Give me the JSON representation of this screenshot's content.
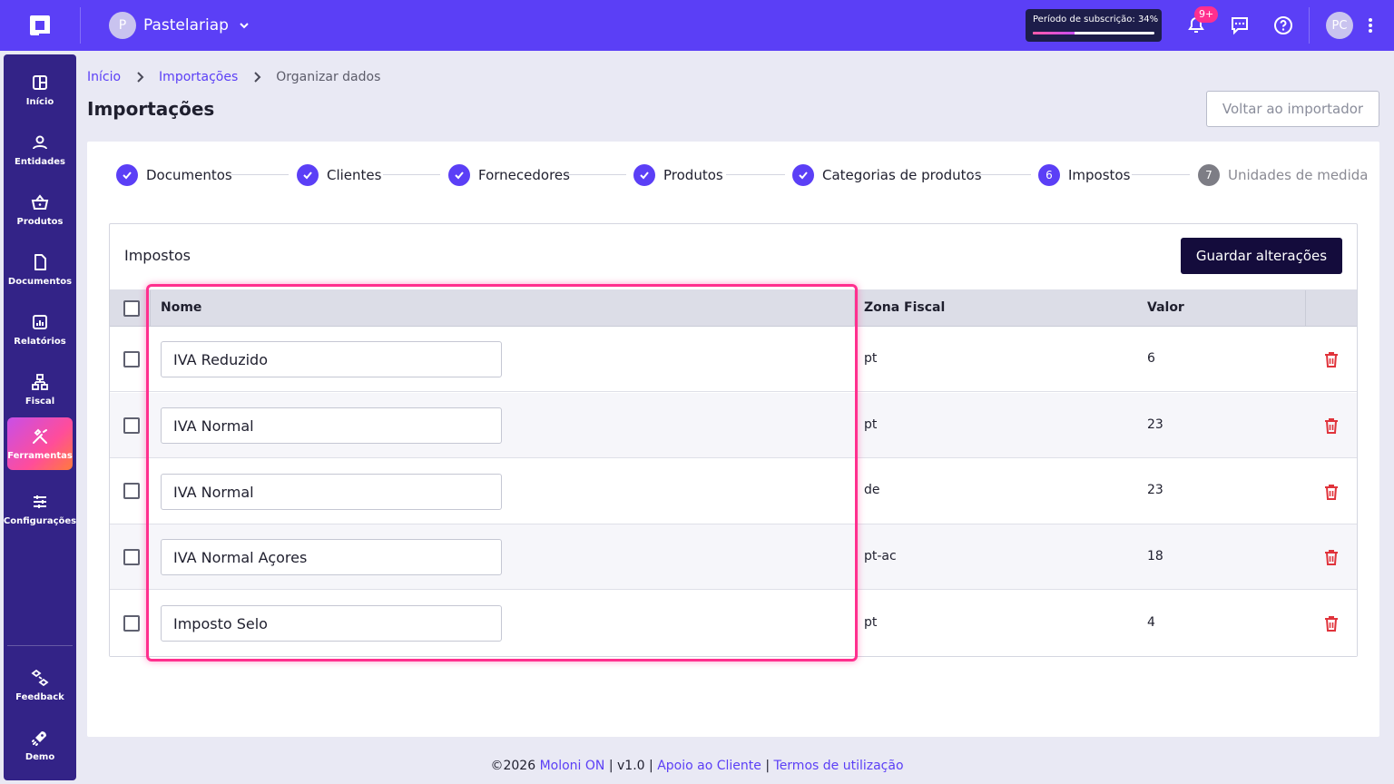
{
  "topbar": {
    "company_initial": "P",
    "company_name": "Pastelariap",
    "subscription_label": "Período de subscrição: 34%",
    "subscription_progress": 0.34,
    "notifications_badge": "9+",
    "user_initials": "PC"
  },
  "sidebar": {
    "items": [
      {
        "label": "Início",
        "icon": "home-icon"
      },
      {
        "label": "Entidades",
        "icon": "person-icon"
      },
      {
        "label": "Produtos",
        "icon": "basket-icon"
      },
      {
        "label": "Documentos",
        "icon": "document-icon"
      },
      {
        "label": "Relatórios",
        "icon": "report-icon"
      },
      {
        "label": "Fiscal",
        "icon": "fiscal-icon"
      },
      {
        "label": "Ferramentas",
        "icon": "tools-icon",
        "active": true
      },
      {
        "label": "Configurações",
        "icon": "settings-icon"
      }
    ],
    "bottom": [
      {
        "label": "Feedback",
        "icon": "feedback-icon"
      },
      {
        "label": "Demo",
        "icon": "rocket-icon"
      }
    ]
  },
  "breadcrumb": {
    "home": "Início",
    "imports": "Importações",
    "current": "Organizar dados"
  },
  "page": {
    "title": "Importações",
    "back_button": "Voltar ao importador"
  },
  "stepper": [
    {
      "label": "Documentos",
      "state": "done"
    },
    {
      "label": "Clientes",
      "state": "done"
    },
    {
      "label": "Fornecedores",
      "state": "done"
    },
    {
      "label": "Produtos",
      "state": "done"
    },
    {
      "label": "Categorias de produtos",
      "state": "done"
    },
    {
      "label": "Impostos",
      "state": "current",
      "number": "6"
    },
    {
      "label": "Unidades de medida",
      "state": "todo",
      "number": "7"
    }
  ],
  "panel": {
    "title": "Impostos",
    "save_button": "Guardar alterações",
    "columns": {
      "name": "Nome",
      "zone": "Zona Fiscal",
      "value": "Valor"
    },
    "rows": [
      {
        "name": "IVA Reduzido",
        "zone": "pt",
        "value": "6"
      },
      {
        "name": "IVA Normal",
        "zone": "pt",
        "value": "23"
      },
      {
        "name": "IVA Normal",
        "zone": "de",
        "value": "23"
      },
      {
        "name": "IVA Normal Açores",
        "zone": "pt-ac",
        "value": "18"
      },
      {
        "name": "Imposto Selo",
        "zone": "pt",
        "value": "4"
      }
    ]
  },
  "footer": {
    "copyright": "©2026",
    "brand": "Moloni ON",
    "version": "v1.0",
    "support": "Apoio ao Cliente",
    "terms": "Termos de utilização"
  },
  "colors": {
    "primary": "#5b3ff6",
    "sidebar": "#332387",
    "highlight": "#ff2f8e",
    "delete": "#e0333b",
    "save_button": "#140c3c"
  }
}
